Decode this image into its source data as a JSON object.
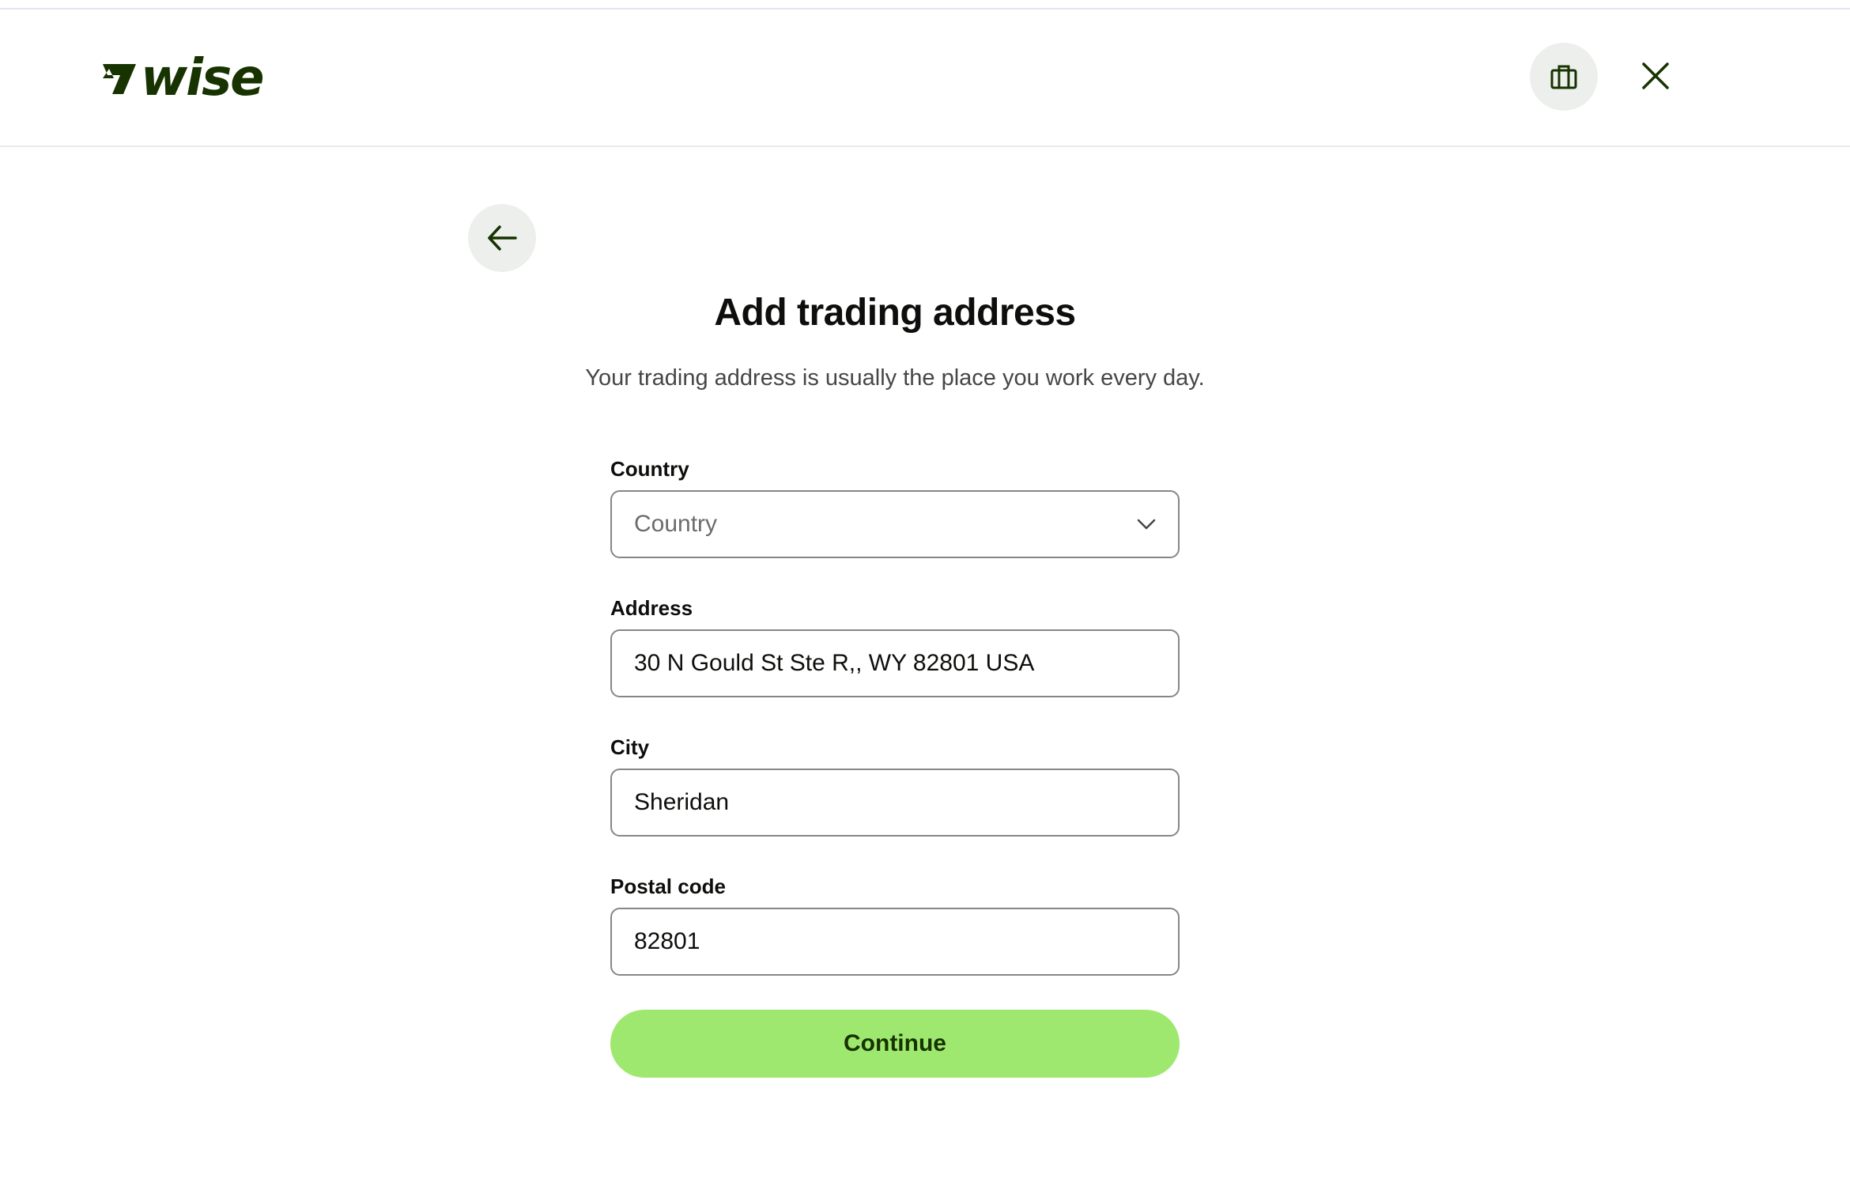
{
  "brand": {
    "name": "wise",
    "color": "#163300",
    "accent": "#9fe870"
  },
  "header": {
    "business_icon": "briefcase-icon",
    "close_icon": "close-icon"
  },
  "page": {
    "back_icon": "arrow-left-icon",
    "title": "Add trading address",
    "subtitle": "Your trading address is usually the place you work every day."
  },
  "form": {
    "country": {
      "label": "Country",
      "placeholder": "Country",
      "value": ""
    },
    "address": {
      "label": "Address",
      "value": "30 N Gould St Ste R,, WY 82801 USA"
    },
    "city": {
      "label": "City",
      "value": "Sheridan"
    },
    "postal_code": {
      "label": "Postal code",
      "value": "82801"
    },
    "continue_label": "Continue"
  }
}
